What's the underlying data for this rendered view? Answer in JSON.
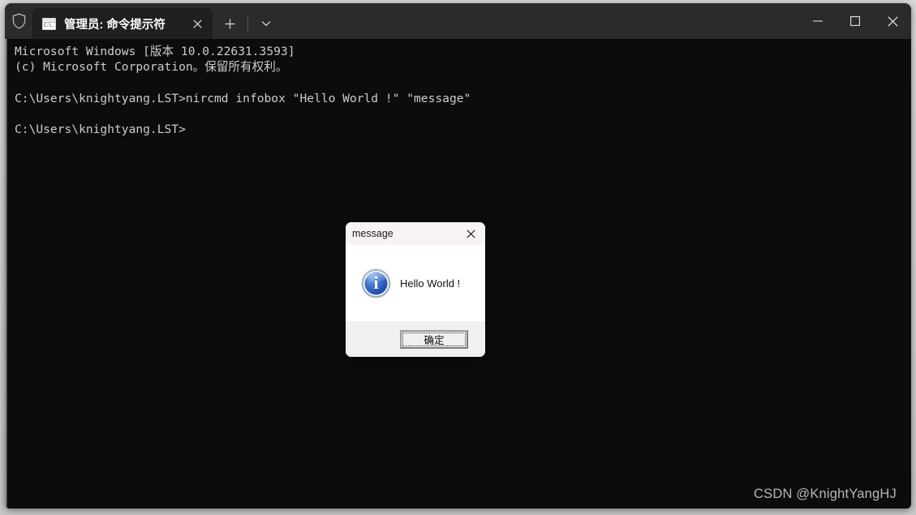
{
  "window": {
    "admin_shield_icon": "shield-icon",
    "tab": {
      "icon": "command-prompt-icon",
      "icon_text": "C:\\.",
      "title": "管理员: 命令提示符",
      "close_icon": "close-icon"
    },
    "new_tab_icon": "plus-icon",
    "tab_dropdown_icon": "chevron-down-icon",
    "controls": {
      "minimize_icon": "minimize-icon",
      "maximize_icon": "maximize-icon",
      "close_icon": "close-icon"
    }
  },
  "terminal": {
    "lines": "Microsoft Windows [版本 10.0.22631.3593]\n(c) Microsoft Corporation。保留所有权利。\n\nC:\\Users\\knightyang.LST>nircmd infobox \"Hello World !\" \"message\"\n\nC:\\Users\\knightyang.LST>",
    "foreground": "#cccccc",
    "background": "#0c0c0c"
  },
  "dialog": {
    "title": "message",
    "close_icon": "close-icon",
    "info_icon": "info-icon",
    "info_glyph": "i",
    "message": "Hello World !",
    "ok_label": "确定"
  },
  "watermark": {
    "text": "CSDN @KnightYangHJ"
  },
  "colors": {
    "titlebar": "#2b2b2b",
    "active_tab": "#1f1f1f",
    "terminal_bg": "#0c0c0c",
    "dialog_titlebar": "#f7f2f5",
    "dialog_buttonbar": "#f0f0f0",
    "info_blue": "#1b49ad"
  }
}
